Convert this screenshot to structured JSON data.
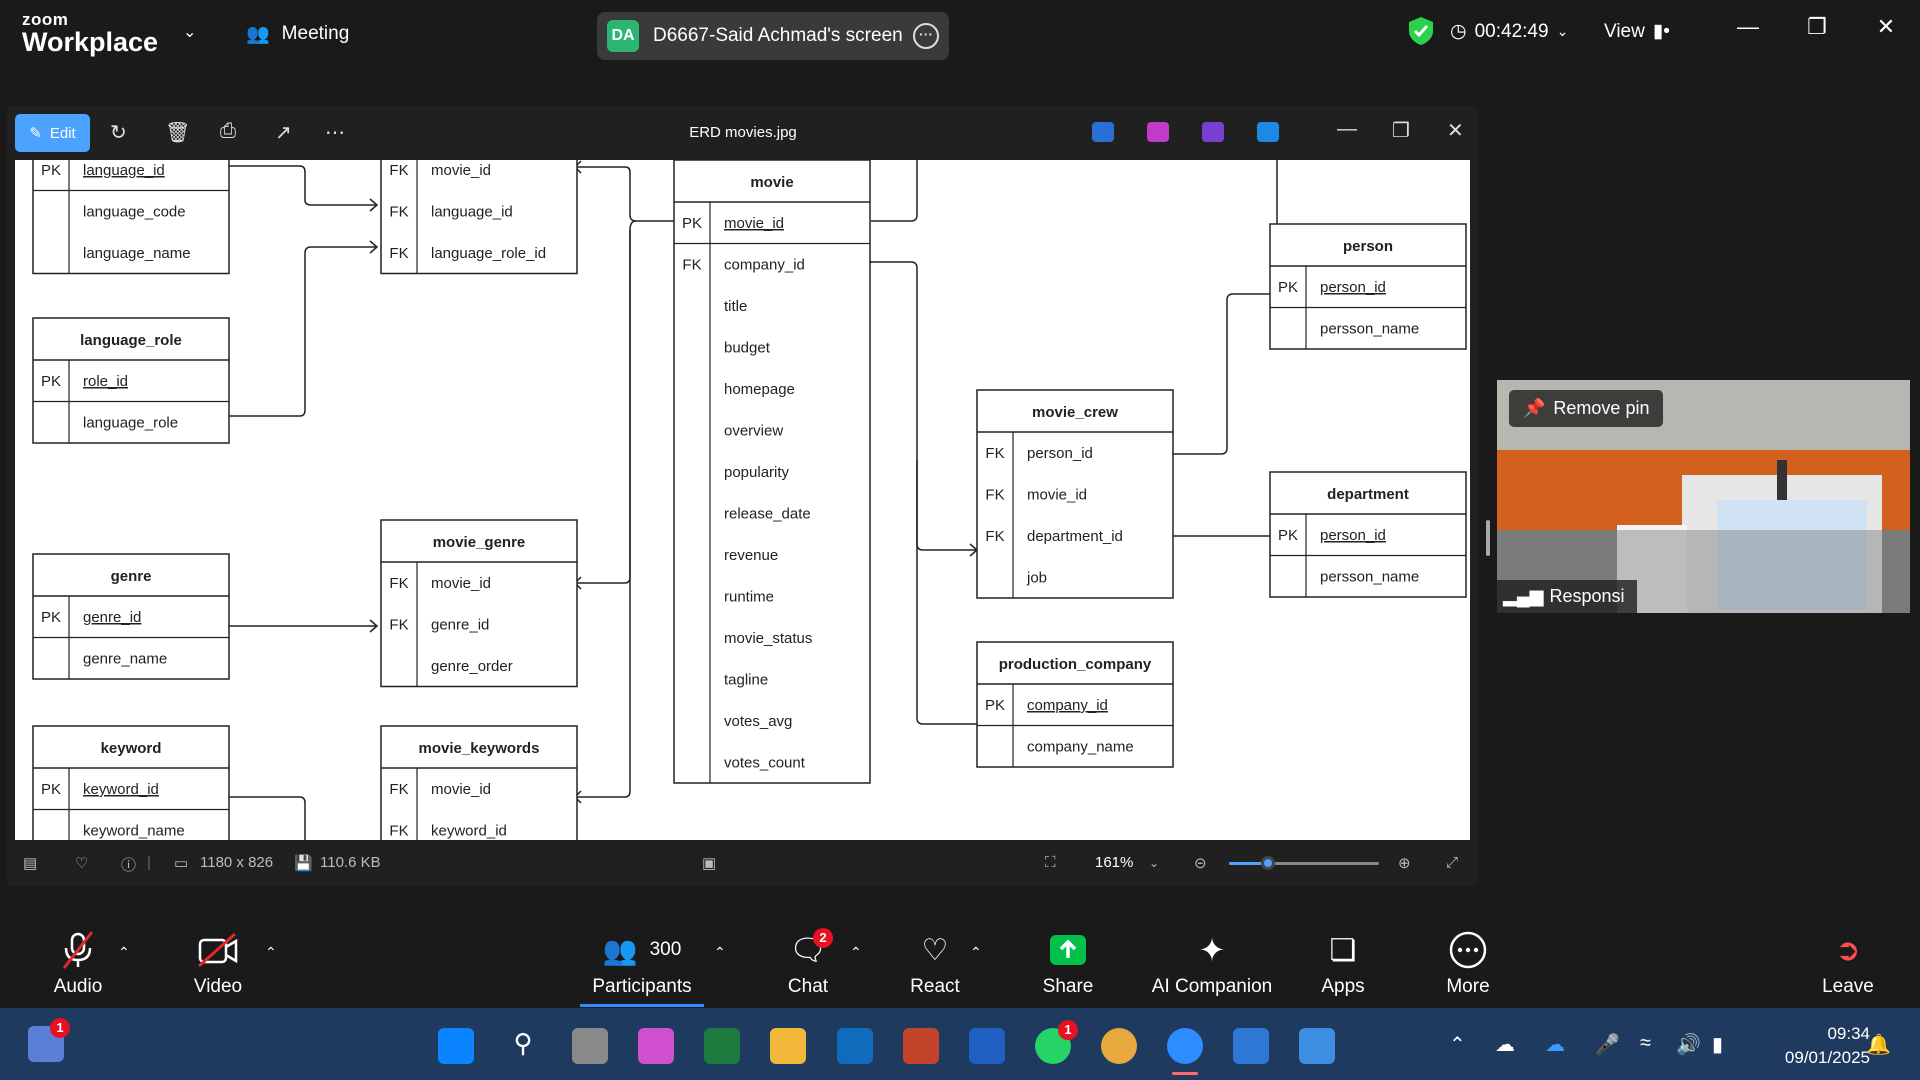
{
  "zoom": {
    "brand_small": "zoom",
    "brand_big": "Workplace",
    "meeting_label": "Meeting",
    "share_initials": "DA",
    "share_label": "D6667-Said Achmad's screen",
    "timer": "00:42:49",
    "view_label": "View"
  },
  "viewer": {
    "edit_label": "Edit",
    "title": "ERD movies.jpg",
    "dimensions": "1180 x 826",
    "file_size": "110.6 KB",
    "zoom_level": "161%"
  },
  "erd": {
    "tables": {
      "language_top": {
        "rows": [
          [
            "PK",
            "language_id"
          ],
          [
            "",
            "language_code"
          ],
          [
            "",
            "language_name"
          ]
        ]
      },
      "movie_languages": {
        "rows": [
          [
            "FK",
            "movie_id"
          ],
          [
            "FK",
            "language_id"
          ],
          [
            "FK",
            "language_role_id"
          ]
        ]
      },
      "movie": {
        "title": "movie",
        "rows": [
          [
            "PK",
            "movie_id"
          ],
          [
            "FK",
            "company_id"
          ],
          [
            "",
            "title"
          ],
          [
            "",
            "budget"
          ],
          [
            "",
            "homepage"
          ],
          [
            "",
            "overview"
          ],
          [
            "",
            "popularity"
          ],
          [
            "",
            "release_date"
          ],
          [
            "",
            "revenue"
          ],
          [
            "",
            "runtime"
          ],
          [
            "",
            "movie_status"
          ],
          [
            "",
            "tagline"
          ],
          [
            "",
            "votes_avg"
          ],
          [
            "",
            "votes_count"
          ]
        ]
      },
      "person": {
        "title": "person",
        "rows": [
          [
            "PK",
            "person_id"
          ],
          [
            "",
            "persson_name"
          ]
        ]
      },
      "language_role": {
        "title": "language_role",
        "rows": [
          [
            "PK",
            "role_id"
          ],
          [
            "",
            "language_role"
          ]
        ]
      },
      "movie_crew": {
        "title": "movie_crew",
        "rows": [
          [
            "FK",
            "person_id"
          ],
          [
            "FK",
            "movie_id"
          ],
          [
            "FK",
            "department_id"
          ],
          [
            "",
            "job"
          ]
        ]
      },
      "department": {
        "title": "department",
        "rows": [
          [
            "PK",
            "person_id"
          ],
          [
            "",
            "persson_name"
          ]
        ]
      },
      "movie_genre": {
        "title": "movie_genre",
        "rows": [
          [
            "FK",
            "movie_id"
          ],
          [
            "FK",
            "genre_id"
          ],
          [
            "",
            "genre_order"
          ]
        ]
      },
      "genre": {
        "title": "genre",
        "rows": [
          [
            "PK",
            "genre_id"
          ],
          [
            "",
            "genre_name"
          ]
        ]
      },
      "production_company": {
        "title": "production_company",
        "rows": [
          [
            "PK",
            "company_id"
          ],
          [
            "",
            "company_name"
          ]
        ]
      },
      "keyword": {
        "title": "keyword",
        "rows": [
          [
            "PK",
            "keyword_id"
          ],
          [
            "",
            "keyword_name"
          ]
        ]
      },
      "movie_keywords": {
        "title": "movie_keywords",
        "rows": [
          [
            "FK",
            "movie_id"
          ],
          [
            "FK",
            "keyword_id"
          ]
        ]
      }
    }
  },
  "tile": {
    "remove_pin": "Remove pin",
    "participant_name": "Responsi"
  },
  "controls": {
    "audio": "Audio",
    "video": "Video",
    "participants": "Participants",
    "participants_count": "300",
    "chat": "Chat",
    "chat_badge": "2",
    "react": "React",
    "share": "Share",
    "ai": "AI Companion",
    "apps": "Apps",
    "more": "More",
    "leave": "Leave"
  },
  "taskbar": {
    "time": "09:34",
    "date": "09/01/2025",
    "copilot_badge": "1",
    "whatsapp_badge": "1"
  },
  "colors": {
    "zoom_bg": "#1a1a1a",
    "edit_accent": "#4ba3ff",
    "share_green": "#00c04b",
    "shield_green": "#2bd14a",
    "chat_badge_red": "#e81123",
    "taskbar": "#1f3a5f"
  }
}
